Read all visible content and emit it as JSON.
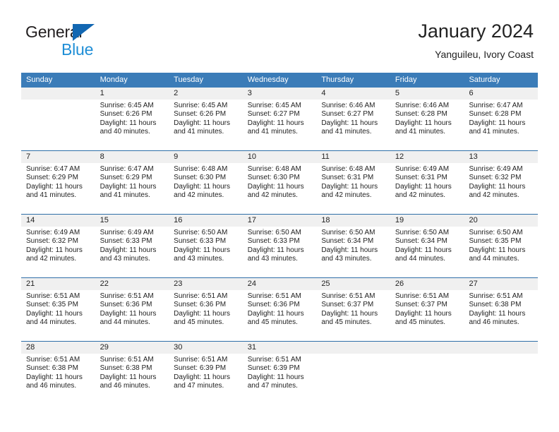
{
  "logo": {
    "word_top": "General",
    "word_bottom": "Blue",
    "triangle_color": "#1267b2",
    "blue_text_color": "#1f8ed6"
  },
  "header": {
    "title": "January 2024",
    "subtitle": "Yanguileu, Ivory Coast",
    "header_bg_color": "#3b7cb8",
    "header_text_color": "#ffffff"
  },
  "weekdays": [
    "Sunday",
    "Monday",
    "Tuesday",
    "Wednesday",
    "Thursday",
    "Friday",
    "Saturday"
  ],
  "labels": {
    "sunrise_prefix": "Sunrise: ",
    "sunset_prefix": "Sunset: ",
    "daylight_prefix": "Daylight: "
  },
  "weeks": [
    [
      {
        "empty": true
      },
      {
        "day": "1",
        "sunrise": "Sunrise: 6:45 AM",
        "sunset": "Sunset: 6:26 PM",
        "daylight_line1": "Daylight: 11 hours",
        "daylight_line2": "and 40 minutes."
      },
      {
        "day": "2",
        "sunrise": "Sunrise: 6:45 AM",
        "sunset": "Sunset: 6:26 PM",
        "daylight_line1": "Daylight: 11 hours",
        "daylight_line2": "and 41 minutes."
      },
      {
        "day": "3",
        "sunrise": "Sunrise: 6:45 AM",
        "sunset": "Sunset: 6:27 PM",
        "daylight_line1": "Daylight: 11 hours",
        "daylight_line2": "and 41 minutes."
      },
      {
        "day": "4",
        "sunrise": "Sunrise: 6:46 AM",
        "sunset": "Sunset: 6:27 PM",
        "daylight_line1": "Daylight: 11 hours",
        "daylight_line2": "and 41 minutes."
      },
      {
        "day": "5",
        "sunrise": "Sunrise: 6:46 AM",
        "sunset": "Sunset: 6:28 PM",
        "daylight_line1": "Daylight: 11 hours",
        "daylight_line2": "and 41 minutes."
      },
      {
        "day": "6",
        "sunrise": "Sunrise: 6:47 AM",
        "sunset": "Sunset: 6:28 PM",
        "daylight_line1": "Daylight: 11 hours",
        "daylight_line2": "and 41 minutes."
      }
    ],
    [
      {
        "day": "7",
        "sunrise": "Sunrise: 6:47 AM",
        "sunset": "Sunset: 6:29 PM",
        "daylight_line1": "Daylight: 11 hours",
        "daylight_line2": "and 41 minutes."
      },
      {
        "day": "8",
        "sunrise": "Sunrise: 6:47 AM",
        "sunset": "Sunset: 6:29 PM",
        "daylight_line1": "Daylight: 11 hours",
        "daylight_line2": "and 41 minutes."
      },
      {
        "day": "9",
        "sunrise": "Sunrise: 6:48 AM",
        "sunset": "Sunset: 6:30 PM",
        "daylight_line1": "Daylight: 11 hours",
        "daylight_line2": "and 42 minutes."
      },
      {
        "day": "10",
        "sunrise": "Sunrise: 6:48 AM",
        "sunset": "Sunset: 6:30 PM",
        "daylight_line1": "Daylight: 11 hours",
        "daylight_line2": "and 42 minutes."
      },
      {
        "day": "11",
        "sunrise": "Sunrise: 6:48 AM",
        "sunset": "Sunset: 6:31 PM",
        "daylight_line1": "Daylight: 11 hours",
        "daylight_line2": "and 42 minutes."
      },
      {
        "day": "12",
        "sunrise": "Sunrise: 6:49 AM",
        "sunset": "Sunset: 6:31 PM",
        "daylight_line1": "Daylight: 11 hours",
        "daylight_line2": "and 42 minutes."
      },
      {
        "day": "13",
        "sunrise": "Sunrise: 6:49 AM",
        "sunset": "Sunset: 6:32 PM",
        "daylight_line1": "Daylight: 11 hours",
        "daylight_line2": "and 42 minutes."
      }
    ],
    [
      {
        "day": "14",
        "sunrise": "Sunrise: 6:49 AM",
        "sunset": "Sunset: 6:32 PM",
        "daylight_line1": "Daylight: 11 hours",
        "daylight_line2": "and 42 minutes."
      },
      {
        "day": "15",
        "sunrise": "Sunrise: 6:49 AM",
        "sunset": "Sunset: 6:33 PM",
        "daylight_line1": "Daylight: 11 hours",
        "daylight_line2": "and 43 minutes."
      },
      {
        "day": "16",
        "sunrise": "Sunrise: 6:50 AM",
        "sunset": "Sunset: 6:33 PM",
        "daylight_line1": "Daylight: 11 hours",
        "daylight_line2": "and 43 minutes."
      },
      {
        "day": "17",
        "sunrise": "Sunrise: 6:50 AM",
        "sunset": "Sunset: 6:33 PM",
        "daylight_line1": "Daylight: 11 hours",
        "daylight_line2": "and 43 minutes."
      },
      {
        "day": "18",
        "sunrise": "Sunrise: 6:50 AM",
        "sunset": "Sunset: 6:34 PM",
        "daylight_line1": "Daylight: 11 hours",
        "daylight_line2": "and 43 minutes."
      },
      {
        "day": "19",
        "sunrise": "Sunrise: 6:50 AM",
        "sunset": "Sunset: 6:34 PM",
        "daylight_line1": "Daylight: 11 hours",
        "daylight_line2": "and 44 minutes."
      },
      {
        "day": "20",
        "sunrise": "Sunrise: 6:50 AM",
        "sunset": "Sunset: 6:35 PM",
        "daylight_line1": "Daylight: 11 hours",
        "daylight_line2": "and 44 minutes."
      }
    ],
    [
      {
        "day": "21",
        "sunrise": "Sunrise: 6:51 AM",
        "sunset": "Sunset: 6:35 PM",
        "daylight_line1": "Daylight: 11 hours",
        "daylight_line2": "and 44 minutes."
      },
      {
        "day": "22",
        "sunrise": "Sunrise: 6:51 AM",
        "sunset": "Sunset: 6:36 PM",
        "daylight_line1": "Daylight: 11 hours",
        "daylight_line2": "and 44 minutes."
      },
      {
        "day": "23",
        "sunrise": "Sunrise: 6:51 AM",
        "sunset": "Sunset: 6:36 PM",
        "daylight_line1": "Daylight: 11 hours",
        "daylight_line2": "and 45 minutes."
      },
      {
        "day": "24",
        "sunrise": "Sunrise: 6:51 AM",
        "sunset": "Sunset: 6:36 PM",
        "daylight_line1": "Daylight: 11 hours",
        "daylight_line2": "and 45 minutes."
      },
      {
        "day": "25",
        "sunrise": "Sunrise: 6:51 AM",
        "sunset": "Sunset: 6:37 PM",
        "daylight_line1": "Daylight: 11 hours",
        "daylight_line2": "and 45 minutes."
      },
      {
        "day": "26",
        "sunrise": "Sunrise: 6:51 AM",
        "sunset": "Sunset: 6:37 PM",
        "daylight_line1": "Daylight: 11 hours",
        "daylight_line2": "and 45 minutes."
      },
      {
        "day": "27",
        "sunrise": "Sunrise: 6:51 AM",
        "sunset": "Sunset: 6:38 PM",
        "daylight_line1": "Daylight: 11 hours",
        "daylight_line2": "and 46 minutes."
      }
    ],
    [
      {
        "day": "28",
        "sunrise": "Sunrise: 6:51 AM",
        "sunset": "Sunset: 6:38 PM",
        "daylight_line1": "Daylight: 11 hours",
        "daylight_line2": "and 46 minutes."
      },
      {
        "day": "29",
        "sunrise": "Sunrise: 6:51 AM",
        "sunset": "Sunset: 6:38 PM",
        "daylight_line1": "Daylight: 11 hours",
        "daylight_line2": "and 46 minutes."
      },
      {
        "day": "30",
        "sunrise": "Sunrise: 6:51 AM",
        "sunset": "Sunset: 6:39 PM",
        "daylight_line1": "Daylight: 11 hours",
        "daylight_line2": "and 47 minutes."
      },
      {
        "day": "31",
        "sunrise": "Sunrise: 6:51 AM",
        "sunset": "Sunset: 6:39 PM",
        "daylight_line1": "Daylight: 11 hours",
        "daylight_line2": "and 47 minutes."
      },
      {
        "empty": true
      },
      {
        "empty": true
      },
      {
        "empty": true
      }
    ]
  ]
}
